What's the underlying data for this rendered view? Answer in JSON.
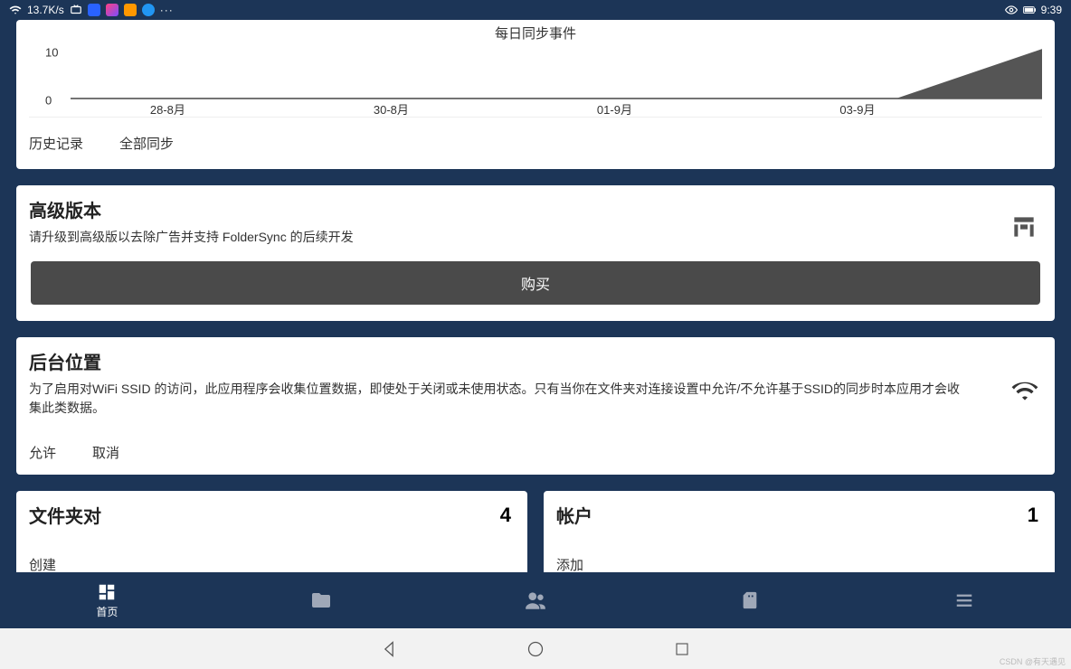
{
  "status": {
    "speed": "13.7K/s",
    "time": "9:39"
  },
  "chart_data": {
    "type": "area",
    "title": "每日同步事件",
    "ylim": [
      0,
      10
    ],
    "yticks": [
      10,
      0
    ],
    "categories": [
      "28-8月",
      "30-8月",
      "01-9月",
      "03-9月"
    ],
    "series": [
      {
        "name": "events",
        "x": [
          0,
          0.85,
          1.0
        ],
        "y": [
          0,
          0,
          10
        ]
      }
    ],
    "actions": {
      "history": "历史记录",
      "sync_all": "全部同步"
    }
  },
  "premium": {
    "title": "高级版本",
    "subtitle": "请升级到高级版以去除广告并支持 FolderSync 的后续开发",
    "buy_label": "购买"
  },
  "location": {
    "title": "后台位置",
    "desc": "为了启用对WiFi SSID 的访问，此应用程序会收集位置数据，即使处于关闭或未使用状态。只有当你在文件夹对连接设置中允许/不允许基于SSID的同步时本应用才会收集此类数据。",
    "allow": "允许",
    "cancel": "取消"
  },
  "pairs": {
    "title": "文件夹对",
    "count": "4",
    "create": "创建"
  },
  "accounts": {
    "title": "帐户",
    "count": "1",
    "add": "添加"
  },
  "nav": {
    "home": "首页"
  },
  "watermark": "CSDN @有天遇见"
}
